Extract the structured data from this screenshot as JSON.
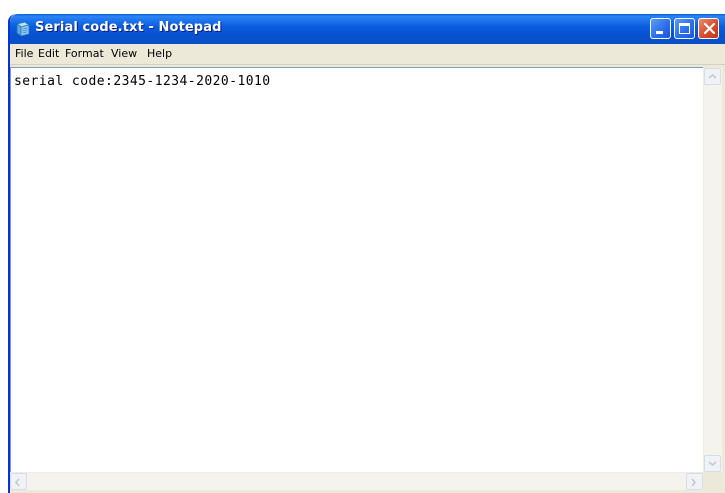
{
  "window": {
    "title": "Serial code.txt - Notepad",
    "app_icon": "notepad-icon",
    "controls": {
      "minimize_icon": "minimize-icon",
      "maximize_icon": "maximize-icon",
      "close_icon": "close-icon"
    }
  },
  "menu": {
    "items": [
      {
        "label": "File"
      },
      {
        "label": "Edit"
      },
      {
        "label": "Format"
      },
      {
        "label": "View"
      },
      {
        "label": "Help"
      }
    ]
  },
  "editor": {
    "content": "serial code:2345-1234-2020-1010"
  },
  "scrollbars": {
    "up_icon": "scroll-up-arrow-icon",
    "down_icon": "scroll-down-arrow-icon",
    "left_icon": "scroll-left-arrow-icon",
    "right_icon": "scroll-right-arrow-icon"
  },
  "colors": {
    "titlebar": "#0b5fe0",
    "close_button": "#d6482a",
    "window_face": "#ece9d8"
  }
}
